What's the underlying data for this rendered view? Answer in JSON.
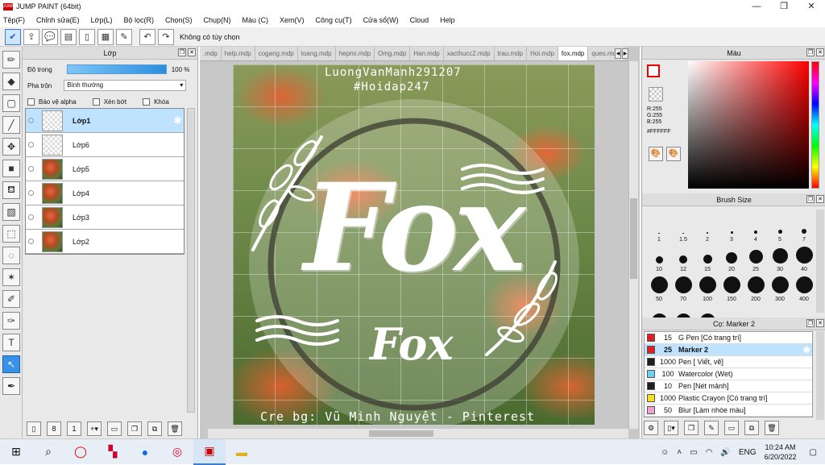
{
  "app": {
    "title": "JUMP PAINT (64bit)",
    "logo_text": "JUMP PAINT"
  },
  "menu": [
    "Tệp(F)",
    "Chỉnh sửa(E)",
    "Lớp(L)",
    "Bộ lọc(R)",
    "Chọn(S)",
    "Chụp(N)",
    "Màu (C)",
    "Xem(V)",
    "Công cụ(T)",
    "Cửa sổ(W)",
    "Cloud",
    "Help"
  ],
  "toolbar": {
    "text": "Không có tùy chọn",
    "icons": [
      "check-icon",
      "export-icon",
      "speech-icon",
      "comment-icon",
      "page-icon",
      "layout-icon",
      "edit-icon",
      "undo-icon",
      "redo-icon"
    ]
  },
  "layer_panel": {
    "title": "Lớp",
    "opacity_label": "Độ trong",
    "opacity_value": "100 %",
    "opacity": 1.0,
    "blend_label": "Pha trộn",
    "blend_value": "Bình thường",
    "checks": [
      "Bảo vệ alpha",
      "Xén bớt",
      "Khóa"
    ],
    "layers": [
      {
        "name": "Lớp1",
        "selected": true,
        "thumb": "trans"
      },
      {
        "name": "Lớp6",
        "selected": false,
        "thumb": "trans"
      },
      {
        "name": "Lớp5",
        "selected": false,
        "thumb": "photo"
      },
      {
        "name": "Lớp4",
        "selected": false,
        "thumb": "photo"
      },
      {
        "name": "Lớp3",
        "selected": false,
        "thumb": "photo"
      },
      {
        "name": "Lớp2",
        "selected": false,
        "thumb": "photo"
      }
    ]
  },
  "tabs": [
    ".mdp",
    "help.mdp",
    "cogang.mdp",
    "toang.mdp",
    "hepmi.mdp",
    "Omg.mdp",
    "Han.mdp",
    "xacthucc2.mdp",
    "trau.mdp",
    "Hoi.mdp",
    "fox.mdp",
    "ques.mdp"
  ],
  "active_tab": "fox.mdp",
  "canvas": {
    "author": "LuongVanManh291207",
    "hashtag": "#Hoidap247",
    "big_title": "Fox",
    "small_title": "Fox",
    "credit": "Cre bg: Vũ Minh Nguyệt - Pinterest"
  },
  "color_panel": {
    "title": "Màu",
    "r": "R:255",
    "g": "G:255",
    "b": "B:255",
    "hex": "#FFFFFF",
    "fg": "#e00000"
  },
  "brush_panel": {
    "title": "Brush Size",
    "sizes": [
      "1",
      "1.5",
      "2",
      "3",
      "4",
      "5",
      "7",
      "10",
      "12",
      "15",
      "20",
      "25",
      "30",
      "40",
      "50",
      "70",
      "100",
      "150",
      "200",
      "300",
      "400",
      "",
      "",
      ""
    ]
  },
  "tool_panel": {
    "title": "Cọ: Marker 2",
    "items": [
      {
        "size": "15",
        "name": "G Pen [Có trang trí]",
        "color": "#e02020",
        "selected": false
      },
      {
        "size": "25",
        "name": "Marker 2",
        "color": "#e02020",
        "selected": true
      },
      {
        "size": "1000",
        "name": "Pen [ Viết, vẽ]",
        "color": "#202020",
        "selected": false
      },
      {
        "size": "100",
        "name": "Watercolor (Wet)",
        "color": "#6fd0f0",
        "selected": false
      },
      {
        "size": "10",
        "name": "Pen [Nét mảnh]",
        "color": "#202020",
        "selected": false
      },
      {
        "size": "1000",
        "name": "Plastic Crayon [Có trang trí]",
        "color": "#f0e020",
        "selected": false
      },
      {
        "size": "50",
        "name": "Blur [Làm nhòe màu]",
        "color": "#f0a0d0",
        "selected": false
      }
    ]
  },
  "taskbar": {
    "lang": "ENG",
    "time": "10:24 AM",
    "date": "6/20/2022"
  }
}
